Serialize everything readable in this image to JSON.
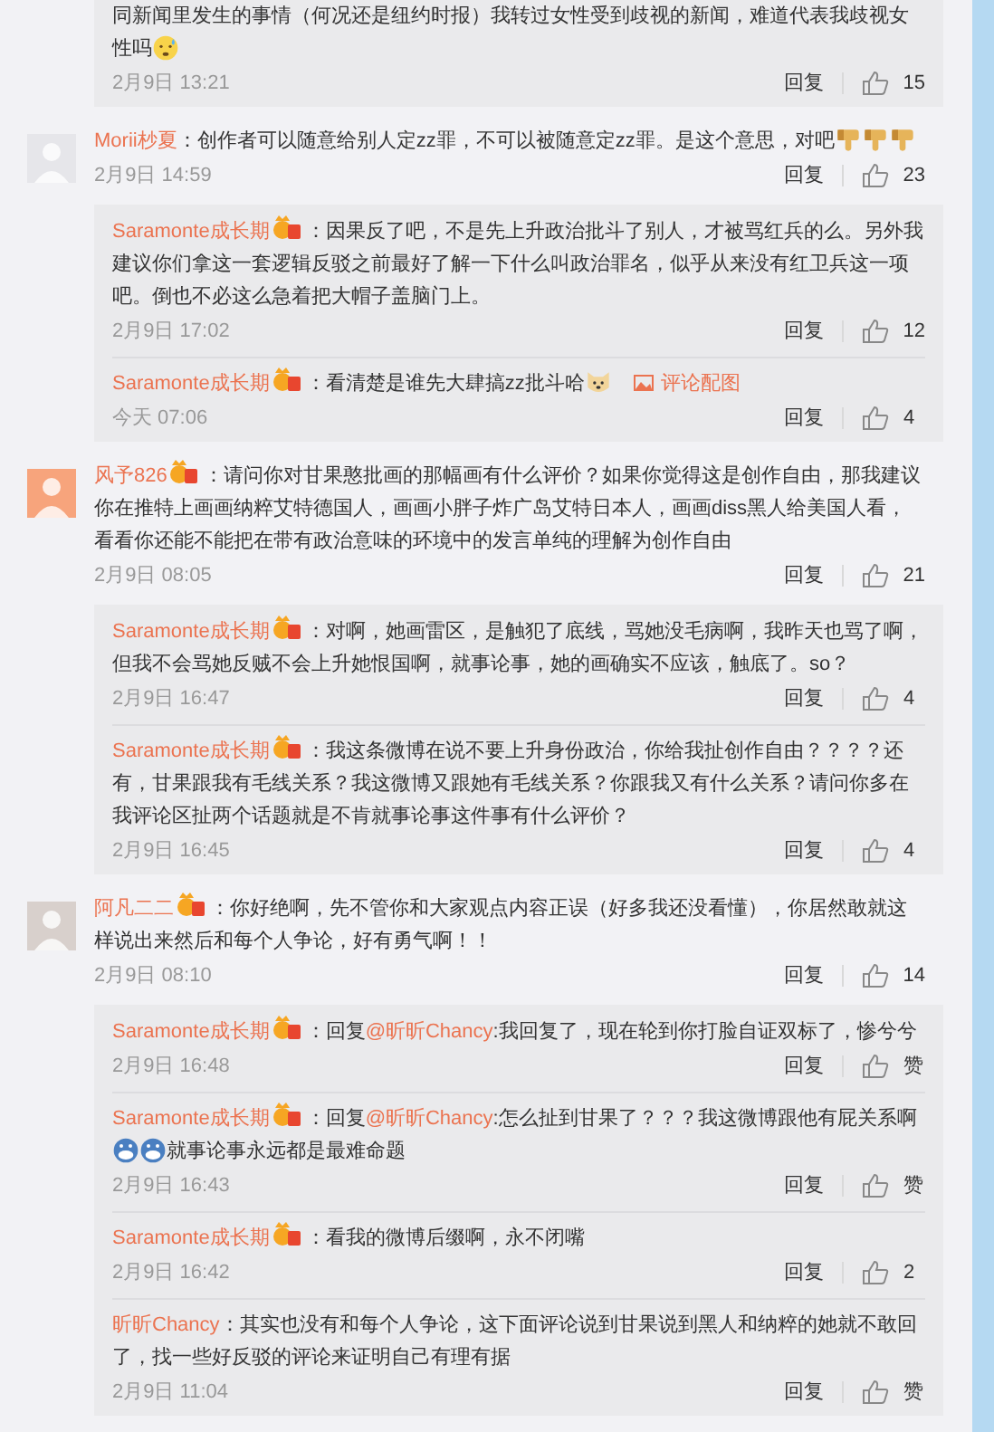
{
  "threads": [
    {
      "replies": [
        {
          "badge": false,
          "parts": [
            {
              "kind": "text",
              "text": "同新闻里发生的事情（何况还是纽约时报）我转过女性受到歧视的新闻，难道代表我歧视女性吗"
            },
            {
              "kind": "emoji_sweat"
            }
          ],
          "time": "2月9日 13:21",
          "reply": "回复",
          "likes": "15"
        }
      ]
    },
    {
      "comment": {
        "author": "Morii杪夏",
        "badge": false,
        "sep": "：",
        "parts": [
          {
            "kind": "text",
            "text": "创作者可以随意给别人定zz罪，不可以被随意定zz罪。是这个意思，对吧"
          },
          {
            "kind": "emoji_thumbdown"
          },
          {
            "kind": "emoji_thumbdown"
          },
          {
            "kind": "emoji_thumbdown"
          }
        ],
        "time": "2月9日 14:59",
        "reply": "回复",
        "likes": "23"
      },
      "replies": [
        {
          "author": "Saramonte成长期",
          "badge": true,
          "sep": "：",
          "parts": [
            {
              "kind": "text",
              "text": "因果反了吧，不是先上升政治批斗了别人，才被骂红兵的么。另外我建议你们拿这一套逻辑反驳之前最好了解一下什么叫政治罪名，似乎从来没有红卫兵这一项吧。倒也不必这么急着把大帽子盖脑门上。"
            }
          ],
          "time": "2月9日 17:02",
          "reply": "回复",
          "likes": "12"
        },
        {
          "author": "Saramonte成长期",
          "badge": true,
          "sep": "：",
          "parts": [
            {
              "kind": "text",
              "text": "看清楚是谁先大肆搞zz批斗哈"
            },
            {
              "kind": "emoji_dog"
            }
          ],
          "attachment": "评论配图",
          "time": "今天 07:06",
          "reply": "回复",
          "likes": "4"
        }
      ]
    },
    {
      "comment": {
        "author": "风予826",
        "badge": true,
        "sep": "：",
        "parts": [
          {
            "kind": "text",
            "text": "请问你对甘果憨批画的那幅画有什么评价？如果你觉得这是创作自由，那我建议你在推特上画画纳粹艾特德国人，画画小胖子炸广岛艾特日本人，画画diss黑人给美国人看，看看你还能不能把在带有政治意味的环境中的发言单纯的理解为创作自由"
          }
        ],
        "time": "2月9日 08:05",
        "reply": "回复",
        "likes": "21"
      },
      "replies": [
        {
          "author": "Saramonte成长期",
          "badge": true,
          "sep": "：",
          "parts": [
            {
              "kind": "text",
              "text": "对啊，她画雷区，是触犯了底线，骂她没毛病啊，我昨天也骂了啊，但我不会骂她反贼不会上升她恨国啊，就事论事，她的画确实不应该，触底了。so？"
            }
          ],
          "time": "2月9日 16:47",
          "reply": "回复",
          "likes": "4"
        },
        {
          "author": "Saramonte成长期",
          "badge": true,
          "sep": "：",
          "parts": [
            {
              "kind": "text",
              "text": "我这条微博在说不要上升身份政治，你给我扯创作自由？？？？还有，甘果跟我有毛线关系？我这微博又跟她有毛线关系？你跟我又有什么关系？请问你多在我评论区扯两个话题就是不肯就事论事这件事有什么评价？"
            }
          ],
          "time": "2月9日 16:45",
          "reply": "回复",
          "likes": "4"
        }
      ]
    },
    {
      "comment": {
        "author": "阿凡二二",
        "badge": true,
        "sep": "：",
        "parts": [
          {
            "kind": "text",
            "text": "你好绝啊，先不管你和大家观点内容正误（好多我还没看懂），你居然敢就这样说出来然后和每个人争论，好有勇气啊！！"
          }
        ],
        "time": "2月9日 08:10",
        "reply": "回复",
        "likes": "14"
      },
      "replies": [
        {
          "author": "Saramonte成长期",
          "badge": true,
          "sep": "：",
          "parts": [
            {
              "kind": "text",
              "text": "回复"
            },
            {
              "kind": "mention",
              "text": "@昕昕Chancy"
            },
            {
              "kind": "text",
              "text": ":我回复了，现在轮到你打脸自证双标了，惨兮兮"
            }
          ],
          "time": "2月9日 16:48",
          "reply": "回复",
          "likes": "赞"
        },
        {
          "author": "Saramonte成长期",
          "badge": true,
          "sep": "：",
          "parts": [
            {
              "kind": "text",
              "text": "回复"
            },
            {
              "kind": "mention",
              "text": "@昕昕Chancy"
            },
            {
              "kind": "text",
              "text": ":怎么扯到甘果了？？？我这微博跟他有屁关系啊"
            },
            {
              "kind": "emoji_shark"
            },
            {
              "kind": "emoji_shark"
            },
            {
              "kind": "text",
              "text": "就事论事永远都是最难命题"
            }
          ],
          "time": "2月9日 16:43",
          "reply": "回复",
          "likes": "赞"
        },
        {
          "author": "Saramonte成长期",
          "badge": true,
          "sep": "：",
          "parts": [
            {
              "kind": "text",
              "text": "看我的微博后缀啊，永不闭嘴"
            }
          ],
          "time": "2月9日 16:42",
          "reply": "回复",
          "likes": "2"
        },
        {
          "author": "昕昕Chancy",
          "badge": false,
          "sep": "：",
          "parts": [
            {
              "kind": "text",
              "text": "其实也没有和每个人争论，这下面评论说到甘果说到黑人和纳粹的她就不敢回了，找一些好反驳的评论来证明自己有理有据"
            }
          ],
          "time": "2月9日 11:04",
          "reply": "回复",
          "likes": "赞"
        }
      ]
    }
  ]
}
